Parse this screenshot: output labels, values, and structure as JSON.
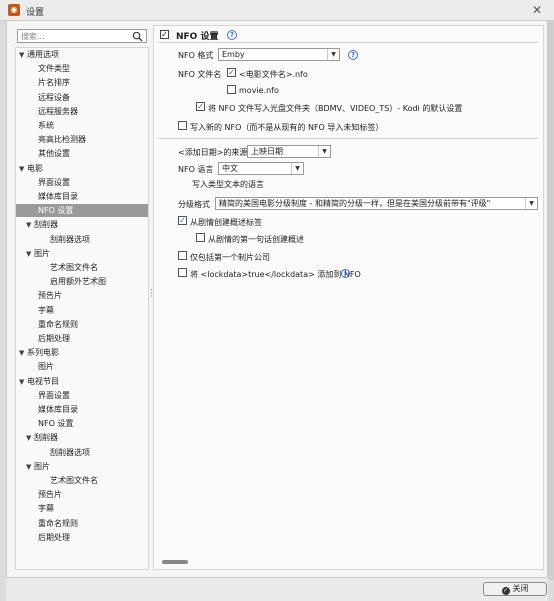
{
  "window": {
    "title": "设置",
    "app_icon": "app-logo-icon",
    "close_glyph": "✕"
  },
  "search": {
    "placeholder": "搜索..."
  },
  "tree": [
    {
      "label": "通用选项",
      "level": 0,
      "caret": "▼"
    },
    {
      "label": "文件类型",
      "level": 2,
      "caret": ""
    },
    {
      "label": "片名排序",
      "level": 2,
      "caret": ""
    },
    {
      "label": "远程设备",
      "level": 2,
      "caret": ""
    },
    {
      "label": "远程服务器",
      "level": 2,
      "caret": ""
    },
    {
      "label": "系统",
      "level": 2,
      "caret": ""
    },
    {
      "label": "亮高比检测器",
      "level": 2,
      "caret": ""
    },
    {
      "label": "其他设置",
      "level": 2,
      "caret": ""
    },
    {
      "label": "电影",
      "level": 0,
      "caret": "▼"
    },
    {
      "label": "界面设置",
      "level": 2,
      "caret": ""
    },
    {
      "label": "媒体库目录",
      "level": 2,
      "caret": ""
    },
    {
      "label": "NFO 设置",
      "level": 2,
      "caret": "",
      "selected": true
    },
    {
      "label": "刮削器",
      "level": 1,
      "caret": "▼"
    },
    {
      "label": "刮削器选项",
      "level": 3,
      "caret": ""
    },
    {
      "label": "图片",
      "level": 1,
      "caret": "▼"
    },
    {
      "label": "艺术图文件名",
      "level": 3,
      "caret": ""
    },
    {
      "label": "启用额外艺术图",
      "level": 3,
      "caret": ""
    },
    {
      "label": "预告片",
      "level": 2,
      "caret": ""
    },
    {
      "label": "字幕",
      "level": 2,
      "caret": ""
    },
    {
      "label": "重命名规则",
      "level": 2,
      "caret": ""
    },
    {
      "label": "后期处理",
      "level": 2,
      "caret": ""
    },
    {
      "label": "系列电影",
      "level": 0,
      "caret": "▼"
    },
    {
      "label": "图片",
      "level": 2,
      "caret": ""
    },
    {
      "label": "电视节目",
      "level": 0,
      "caret": "▼"
    },
    {
      "label": "界面设置",
      "level": 2,
      "caret": ""
    },
    {
      "label": "媒体库目录",
      "level": 2,
      "caret": ""
    },
    {
      "label": "NFO 设置",
      "level": 2,
      "caret": ""
    },
    {
      "label": "刮削器",
      "level": 1,
      "caret": "▼"
    },
    {
      "label": "刮削器选项",
      "level": 3,
      "caret": ""
    },
    {
      "label": "图片",
      "level": 1,
      "caret": "▼"
    },
    {
      "label": "艺术图文件名",
      "level": 3,
      "caret": ""
    },
    {
      "label": "预告片",
      "level": 2,
      "caret": ""
    },
    {
      "label": "字幕",
      "level": 2,
      "caret": ""
    },
    {
      "label": "重命名规则",
      "level": 2,
      "caret": ""
    },
    {
      "label": "后期处理",
      "level": 2,
      "caret": ""
    }
  ],
  "panel": {
    "header": {
      "title": "NFO 设置",
      "checked": true,
      "check_glyph": "✓",
      "help_glyph": "?"
    },
    "nfo_format": {
      "label": "NFO 格式",
      "value": "Emby"
    },
    "nfo_filename": {
      "label": "NFO 文件名",
      "opt1": {
        "label": "<电影文件名>.nfo",
        "checked": true
      },
      "opt2": {
        "label": "movie.nfo",
        "checked": false
      }
    },
    "disc_folder": {
      "label": "将 NFO 文件写入光盘文件夹（BDMV、VIDEO_TS）- Kodi 的默认设置",
      "checked": true
    },
    "write_new": {
      "label": "写入新的 NFO（而不是从现有的 NFO 导入未知标签）",
      "checked": false
    },
    "date_added": {
      "label": "<添加日期>的来源",
      "value": "上映日期"
    },
    "nfo_language": {
      "label": "NFO 语言",
      "value": "中文",
      "hint": "写入类型文本的语言"
    },
    "certification": {
      "label": "分级格式",
      "value": "精简的美国电影分级制度 - 和精简的分级一样，但是在美国分级前带有\"评级\""
    },
    "outline_from_plot": {
      "label": "从剧情创建概述标签",
      "checked": true
    },
    "outline_first_sentence": {
      "label": "从剧情的第一句话创建概述",
      "checked": false
    },
    "single_studio": {
      "label": "仅包括第一个制片公司",
      "checked": false
    },
    "lockdata": {
      "label": "将 <lockdata>true</lockdata> 添加到 NFO",
      "checked": false
    }
  },
  "footer": {
    "close_label": "关闭",
    "close_icon": "close-circle-icon"
  },
  "colors": {
    "selected": "#9a9a9a",
    "accent": "#3b6fd6",
    "app_icon": "#c05a18"
  }
}
